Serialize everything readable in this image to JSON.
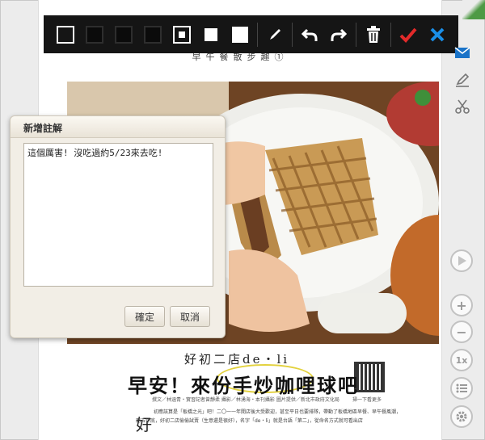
{
  "colors": {
    "toolbar_bg": "#151515",
    "confirm_red": "#e22a2a",
    "cancel_blue": "#1a8fe8",
    "highlight_yellow": "#e3d23e",
    "dialog_bg": "#f2eee6"
  },
  "toolbar": {
    "tools": [
      {
        "name": "rect-outline-icon"
      },
      {
        "name": "rect-dim-1-icon"
      },
      {
        "name": "rect-dim-2-icon"
      },
      {
        "name": "rect-dim-3-icon"
      },
      {
        "name": "rect-dot-icon"
      },
      {
        "name": "rect-filled-small-icon"
      },
      {
        "name": "rect-filled-large-icon"
      },
      {
        "name": "pen-icon"
      },
      {
        "name": "undo-icon"
      },
      {
        "name": "redo-icon"
      },
      {
        "name": "trash-icon"
      },
      {
        "name": "check-icon"
      },
      {
        "name": "close-icon"
      }
    ]
  },
  "magazine": {
    "header": "早午餐散步趣①",
    "shop_name": "好初二店de・li",
    "headline": "早安！來份手炒咖哩球吧",
    "credits": "撰文／林涵青・實習記者曾靜柔 攝影／林湧海・本刊攝影 圖片提供／新北市政府文化局",
    "qr_caption": "掃一下看更多",
    "drop_cap": "好",
    "body_text": "初應該算是「板橋之光」吧！二〇一一年開店後大受歡迎，甚至平日也要排隊，帶動了板橋地區早餐、早午餐風潮，而去年底，好初二店偷偷試賣（生意還是很好），名字「de・li」就是台語「第二」，從命名方式就可看出店"
  },
  "sidebar": {
    "icons": [
      "mail-icon",
      "highlighter-icon",
      "scissors-icon"
    ],
    "play_icon": "play-icon",
    "zoom_in": "+",
    "zoom_out": "−",
    "zoom_level": "1x",
    "list_icon": "list-icon",
    "settings_icon": "gear-icon"
  },
  "dialog": {
    "title": "新增註解",
    "note_text": "這個厲害! 沒吃過約5/23來去吃!",
    "ok_label": "確定",
    "cancel_label": "取消"
  }
}
